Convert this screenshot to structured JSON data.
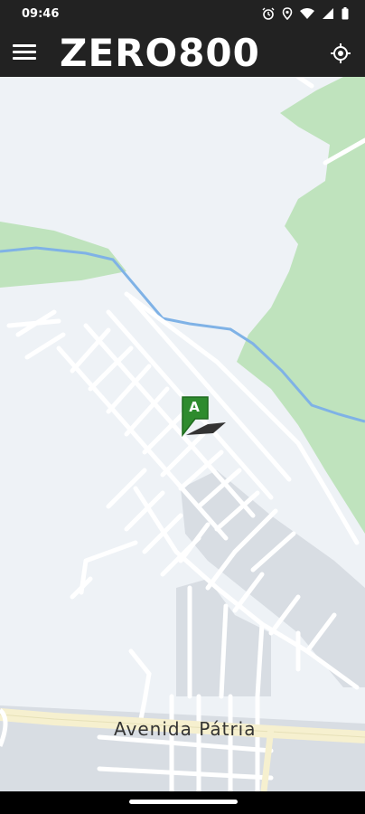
{
  "status_bar": {
    "time": "09:46",
    "icons": [
      "alarm-icon",
      "location-icon",
      "wifi-icon",
      "signal-icon",
      "battery-icon"
    ]
  },
  "app_bar": {
    "menu_icon": "hamburger-menu-icon",
    "brand": "ZERO800",
    "locate_icon": "my-location-icon"
  },
  "map": {
    "street_label": "Avenida Pátria",
    "marker": {
      "label": "A",
      "color": "#2e8b2e"
    },
    "colors": {
      "background": "#eef2f6",
      "park": "#bfe3bd",
      "water": "#7fb2e6",
      "road": "#ffffff",
      "avenue": "#f6f0cf",
      "block": "#d8dde3"
    }
  },
  "nav_bar": {
    "home_indicator": "home-pill"
  }
}
